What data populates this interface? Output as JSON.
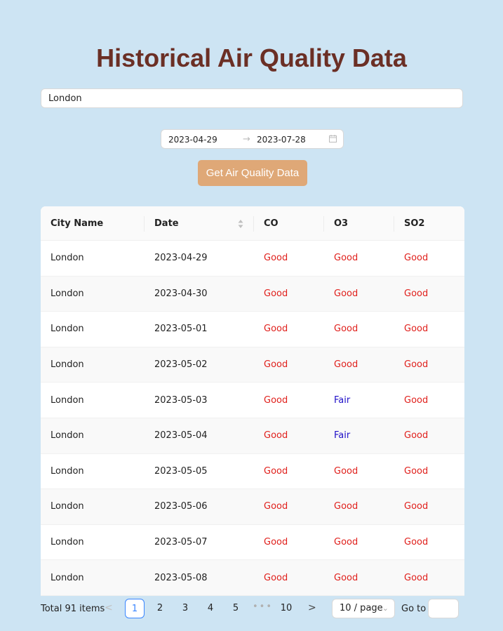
{
  "title": "Historical Air Quality Data",
  "search": {
    "value": "London"
  },
  "date_range": {
    "start": "2023-04-29",
    "separator": "→",
    "end": "2023-07-28"
  },
  "action_button": "Get Air Quality Data",
  "table": {
    "columns": [
      "City Name",
      "Date",
      "CO",
      "O3",
      "SO2"
    ],
    "rows": [
      [
        "London",
        "2023-04-29",
        "Good",
        "Good",
        "Good"
      ],
      [
        "London",
        "2023-04-30",
        "Good",
        "Good",
        "Good"
      ],
      [
        "London",
        "2023-05-01",
        "Good",
        "Good",
        "Good"
      ],
      [
        "London",
        "2023-05-02",
        "Good",
        "Good",
        "Good"
      ],
      [
        "London",
        "2023-05-03",
        "Good",
        "Fair",
        "Good"
      ],
      [
        "London",
        "2023-05-04",
        "Good",
        "Fair",
        "Good"
      ],
      [
        "London",
        "2023-05-05",
        "Good",
        "Good",
        "Good"
      ],
      [
        "London",
        "2023-05-06",
        "Good",
        "Good",
        "Good"
      ],
      [
        "London",
        "2023-05-07",
        "Good",
        "Good",
        "Good"
      ],
      [
        "London",
        "2023-05-08",
        "Good",
        "Good",
        "Good"
      ]
    ]
  },
  "pagination": {
    "total": "Total 91 items",
    "prev": "<",
    "pages": [
      "1",
      "2",
      "3",
      "4",
      "5"
    ],
    "ellipsis": "•••",
    "last_page": "10",
    "next": ">",
    "page_size": "10 / page",
    "goto_label": "Go to",
    "active_page": "1"
  },
  "colors": {
    "background": "#cde4f3",
    "title": "#6b2f25",
    "button": "#dfa877",
    "good": "#e0201c",
    "fair": "#2010c8",
    "accent": "#3a86ff"
  }
}
